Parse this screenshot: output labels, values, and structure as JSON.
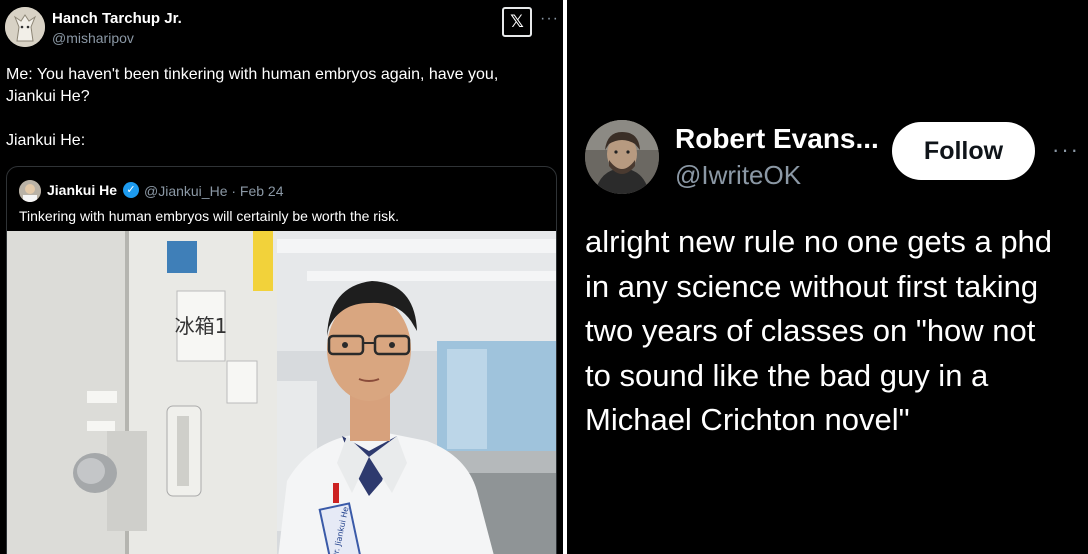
{
  "left_tweet": {
    "author_name": "Hanch Tarchup Jr.",
    "author_handle": "@misharipov",
    "text_lines": [
      "Me: You haven't been tinkering with human embryos again, have you,",
      "Jiankui He?",
      "",
      "Jiankui He:"
    ],
    "logo_glyph": "𝕏",
    "more_glyph": "···",
    "quoted": {
      "author_name": "Jiankui He",
      "verified_glyph": "✓",
      "handle_and_date": "@Jiankui_He · Feb 24",
      "text": "Tinkering with human embryos will certainly be worth the risk.",
      "photo_sign_text": "冰箱1",
      "photo_badge_text": "Dr. Jiankui He"
    }
  },
  "right_tweet": {
    "author_name": "Robert Evans...",
    "author_handle": "@IwriteOK",
    "follow_label": "Follow",
    "more_glyph": "···",
    "text_lines": [
      "alright new rule no one gets a phd",
      "in any science without first taking",
      "two years of classes on \"how not",
      "to sound like the bad guy in a",
      "Michael Crichton novel\""
    ]
  },
  "icons": [
    "x-logo-icon",
    "more-icon",
    "verified-badge-icon"
  ],
  "colors": {
    "background": "#000000",
    "text": "#e7e9ea",
    "secondary_text": "#8b98a5",
    "verified_blue": "#1d9bf0",
    "follow_button": "#ffffff"
  }
}
